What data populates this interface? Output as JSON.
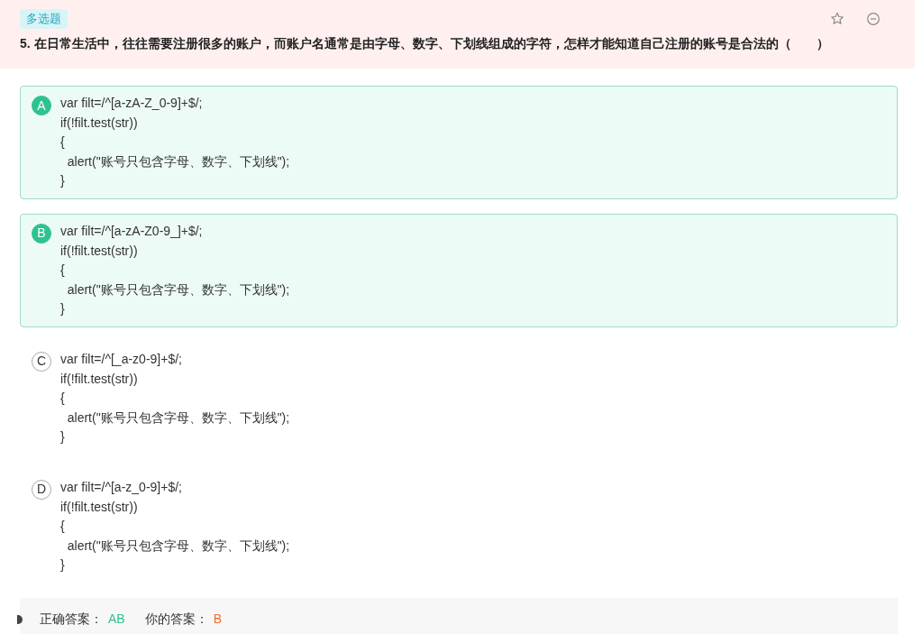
{
  "question": {
    "type_tag": "多选题",
    "number": "5.",
    "text": "在日常生活中，往往需要注册很多的账户，而账户名通常是由字母、数字、下划线组成的字符，怎样才能知道自己注册的账号是合法的（　　）"
  },
  "options": [
    {
      "letter": "A",
      "selected": true,
      "lines": [
        "var filt=/^[a-zA-Z_0-9]+$/;",
        "if(!filt.test(str))",
        "{",
        "  alert(\"账号只包含字母、数字、下划线\");",
        "}"
      ]
    },
    {
      "letter": "B",
      "selected": true,
      "lines": [
        "var filt=/^[a-zA-Z0-9_]+$/;",
        "if(!filt.test(str))",
        "{",
        "  alert(\"账号只包含字母、数字、下划线\");",
        "}"
      ]
    },
    {
      "letter": "C",
      "selected": false,
      "lines": [
        "var filt=/^[_a-z0-9]+$/;",
        "if(!filt.test(str))",
        "{",
        "  alert(\"账号只包含字母、数字、下划线\");",
        "}"
      ]
    },
    {
      "letter": "D",
      "selected": false,
      "lines": [
        "var filt=/^[a-z_0-9]+$/;",
        "if(!filt.test(str))",
        "{",
        "  alert(\"账号只包含字母、数字、下划线\");",
        "}"
      ]
    }
  ],
  "answer": {
    "correct_label": "正确答案：",
    "correct": "AB",
    "yours_label": "你的答案：",
    "yours": "B"
  }
}
